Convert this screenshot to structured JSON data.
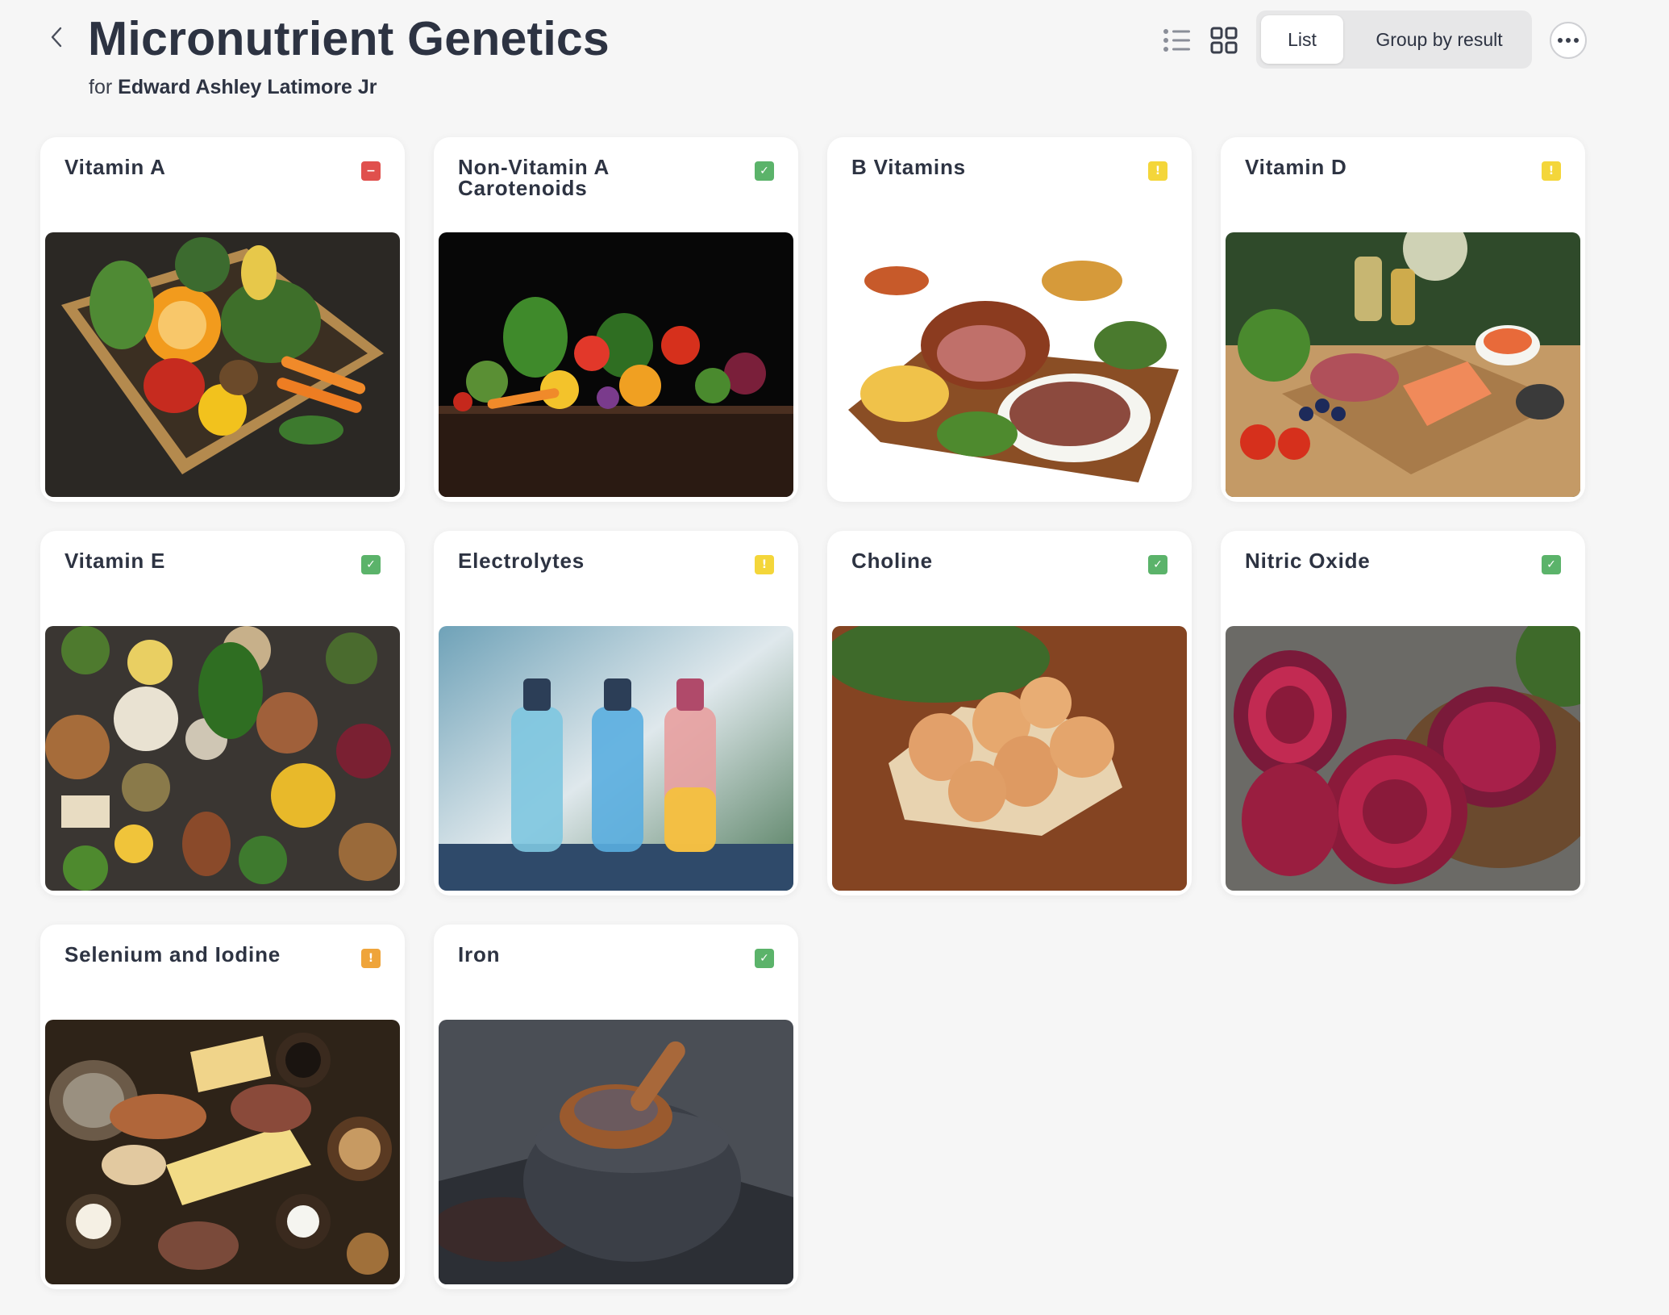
{
  "header": {
    "title": "Micronutrient Genetics",
    "subtitle_prefix": "for",
    "person_name": "Edward Ashley Latimore Jr",
    "view_toggle": {
      "list": "List",
      "group": "Group by result",
      "selected": "List"
    }
  },
  "colors": {
    "status_ok": "#5bb36a",
    "status_bad": "#e0504d",
    "status_warn_yellow": "#f4d63a",
    "status_warn_orange": "#efa43a"
  },
  "cards": [
    {
      "title": "Vitamin A",
      "status": "bad",
      "image": "vegetable-tray"
    },
    {
      "title": "Non-Vitamin A Carotenoids",
      "status": "ok",
      "image": "colorful-vegetables"
    },
    {
      "title": "B Vitamins",
      "status": "warn-yellow",
      "image": "meat-platter"
    },
    {
      "title": "Vitamin D",
      "status": "warn-yellow",
      "image": "outdoor-spread"
    },
    {
      "title": "Vitamin E",
      "status": "ok",
      "image": "nuts-and-greens"
    },
    {
      "title": "Electrolytes",
      "status": "warn-yellow",
      "image": "water-bottles"
    },
    {
      "title": "Choline",
      "status": "ok",
      "image": "eggs"
    },
    {
      "title": "Nitric Oxide",
      "status": "ok",
      "image": "beets"
    },
    {
      "title": "Selenium and Iodine",
      "status": "warn-orange",
      "image": "cheese-and-nuts"
    },
    {
      "title": "Iron",
      "status": "ok",
      "image": "mortar-spoon"
    }
  ]
}
